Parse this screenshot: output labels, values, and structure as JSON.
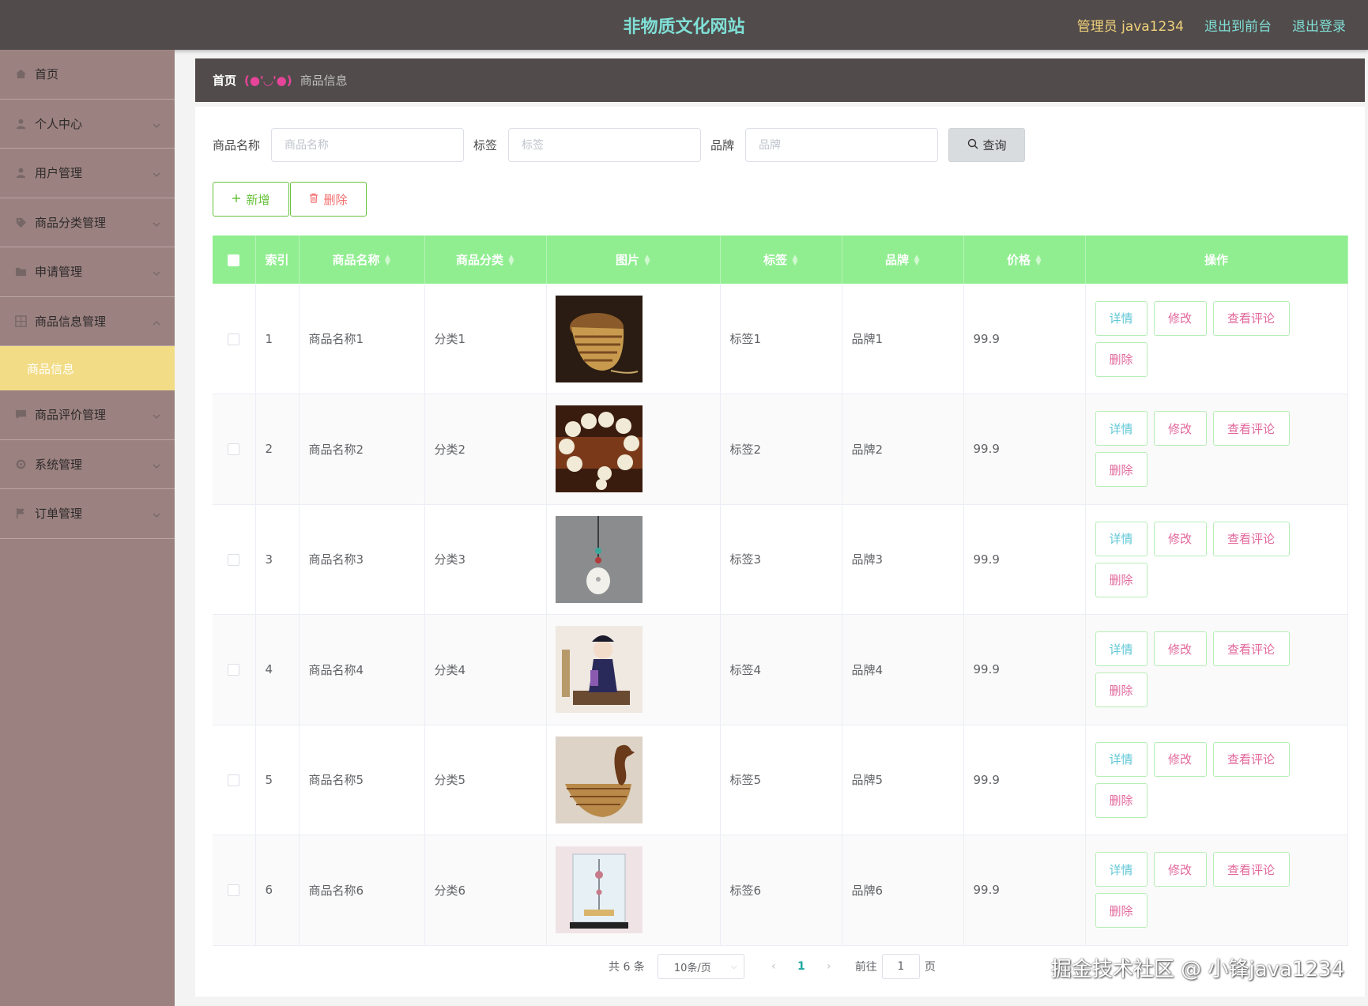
{
  "header": {
    "title": "非物质文化网站",
    "admin": "管理员 java1234",
    "front_link": "退出到前台",
    "logout_link": "退出登录"
  },
  "sidebar": {
    "items": [
      {
        "label": "首页",
        "icon": "home-icon",
        "has_children": false
      },
      {
        "label": "个人中心",
        "icon": "user-icon",
        "has_children": true
      },
      {
        "label": "用户管理",
        "icon": "user-icon",
        "has_children": true
      },
      {
        "label": "商品分类管理",
        "icon": "tag-icon",
        "has_children": true
      },
      {
        "label": "申请管理",
        "icon": "folder-icon",
        "has_children": true
      },
      {
        "label": "商品信息管理",
        "icon": "grid-icon",
        "has_children": true
      }
    ],
    "active_sub": "商品信息",
    "items_after": [
      {
        "label": "商品评价管理",
        "icon": "chat-icon",
        "has_children": true
      },
      {
        "label": "系统管理",
        "icon": "gear-icon",
        "has_children": true
      },
      {
        "label": "订单管理",
        "icon": "flag-icon",
        "has_children": true
      }
    ]
  },
  "breadcrumb": {
    "home": "首页",
    "emoji": "(●'◡'●)",
    "current": "商品信息"
  },
  "search": {
    "name_label": "商品名称",
    "name_placeholder": "商品名称",
    "tag_label": "标签",
    "tag_placeholder": "标签",
    "brand_label": "品牌",
    "brand_placeholder": "品牌",
    "query_button": "查询"
  },
  "actions": {
    "add": "新增",
    "delete": "删除"
  },
  "table": {
    "columns": [
      "索引",
      "商品名称",
      "商品分类",
      "图片",
      "标签",
      "品牌",
      "价格",
      "操作"
    ],
    "rows": [
      {
        "index": "1",
        "name": "商品名称1",
        "category": "分类1",
        "image": "bamboo-basket",
        "tag": "标签1",
        "brand": "品牌1",
        "price": "99.9"
      },
      {
        "index": "2",
        "name": "商品名称2",
        "category": "分类2",
        "image": "bead-bracelet",
        "tag": "标签2",
        "brand": "品牌2",
        "price": "99.9"
      },
      {
        "index": "3",
        "name": "商品名称3",
        "category": "分类3",
        "image": "jade-pendant",
        "tag": "标签3",
        "brand": "品牌3",
        "price": "99.9"
      },
      {
        "index": "4",
        "name": "商品名称4",
        "category": "分类4",
        "image": "opera-doll",
        "tag": "标签4",
        "brand": "品牌4",
        "price": "99.9"
      },
      {
        "index": "5",
        "name": "商品名称5",
        "category": "分类5",
        "image": "bamboo-swan",
        "tag": "标签5",
        "brand": "品牌5",
        "price": "99.9"
      },
      {
        "index": "6",
        "name": "商品名称6",
        "category": "分类6",
        "image": "glass-tower-model",
        "tag": "标签6",
        "brand": "品牌6",
        "price": "99.9"
      }
    ],
    "row_actions": {
      "detail": "详情",
      "edit": "修改",
      "comment": "查看评论",
      "delete": "删除"
    }
  },
  "pagination": {
    "total": "共 6 条",
    "page_size": "10条/页",
    "current_page": "1",
    "goto_label": "前往",
    "goto_value": "1",
    "page_suffix": "页"
  },
  "watermark": "掘金技术社区 @ 小锋java1234",
  "colors": {
    "topbar": "#524b4b",
    "sidebar": "#9b8281",
    "active_sub": "#f2dc86",
    "table_header": "#90ee90",
    "title": "#7fe0d6"
  }
}
